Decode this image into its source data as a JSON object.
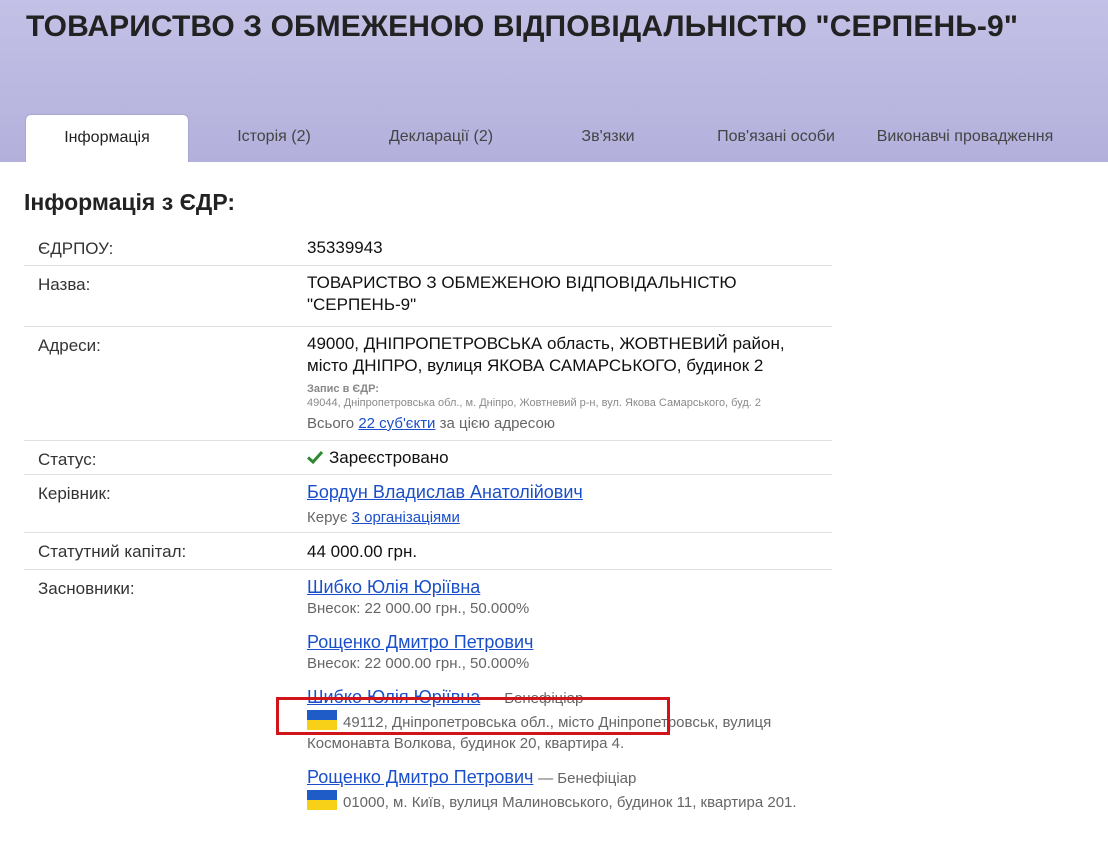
{
  "header": {
    "title": "ТОВАРИСТВО З ОБМЕЖЕНОЮ ВІДПОВІДАЛЬНІСТЮ \"СЕРПЕНЬ-9\"",
    "tabs": [
      "Інформація",
      "Історія (2)",
      "Декларації (2)",
      "Зв'язки",
      "Пов'язані особи",
      "Виконавчі провадження"
    ],
    "active_tab": "Інформація"
  },
  "section_title": "Інформація з ЄДР:",
  "edrpou": {
    "label": "ЄДРПОУ:",
    "value": "35339943"
  },
  "name": {
    "label": "Назва:",
    "value": "ТОВАРИСТВО З ОБМЕЖЕНОЮ ВІДПОВІДАЛЬНІСТЮ \"СЕРПЕНЬ-9\""
  },
  "address": {
    "label": "Адреси:",
    "value": "49000, ДНІПРОПЕТРОВСЬКА область, ЖОВТНЕВИЙ район, місто ДНІПРО, вулиця ЯКОВА САМАРСЬКОГО, будинок 2",
    "edr_record_label": "Запис в ЄДР:",
    "edr_record": "49044, Дніпропетровська обл., м. Дніпро, Жовтневий р-н, вул. Якова Самарського, буд. 2",
    "subjects_prefix": "Всього",
    "subjects_link": "22 суб'єкти",
    "subjects_suffix": "за цією адресою"
  },
  "status": {
    "label": "Статус:",
    "value": "Зареєстровано",
    "icon": "check-icon",
    "color": "#2f6f2f"
  },
  "director": {
    "label": "Керівник:",
    "name": "Бордун Владислав Анатолійович",
    "manages_prefix": "Керує",
    "manages_link": "3 організаціями"
  },
  "capital": {
    "label": "Статутний капітал:",
    "value": "44 000.00 грн."
  },
  "founders": {
    "label": "Засновники:",
    "items": [
      {
        "name": "Шибко Юлія Юріївна",
        "share": "Внесок: 22 000.00 грн., 50.000%"
      },
      {
        "name": "Рощенко Дмитро Петрович",
        "share": "Внесок: 22 000.00 грн., 50.000%"
      }
    ],
    "beneficiaries": [
      {
        "name": "Шибко Юлія Юріївна",
        "role": "— Бенефіціар",
        "address": "49112, Дніпропетровська обл., місто Дніпропетровськ, вулиця Космонавта Волкова, будинок 20, квартира 4.",
        "flag": "ukraine-flag-icon"
      },
      {
        "name": "Рощенко Дмитро Петрович",
        "role": "— Бенефіціар",
        "address": "01000, м. Київ, вулиця Малиновського, будинок 11, квартира 201.",
        "flag": "ukraine-flag-icon"
      }
    ]
  },
  "highlight_color": "#d1141a",
  "link_color": "#1a4fc9"
}
